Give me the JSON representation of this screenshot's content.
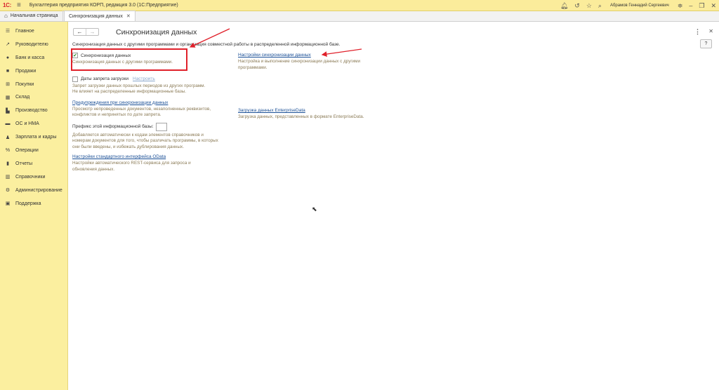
{
  "titlebar": {
    "logo": "1С:",
    "app_title": "Бухгалтерия предприятия КОРП, редакция 3.0  (1С:Предприятие)",
    "user_name": "Абрамов Геннадий Сергеевич"
  },
  "tabs": {
    "home": "Начальная страница",
    "active": "Синхронизация данных"
  },
  "sidebar": {
    "items": [
      {
        "label": "Главное",
        "icon": "menu-icon"
      },
      {
        "label": "Руководителю",
        "icon": "trend-icon"
      },
      {
        "label": "Банк и касса",
        "icon": "coins-icon"
      },
      {
        "label": "Продажи",
        "icon": "bag-icon"
      },
      {
        "label": "Покупки",
        "icon": "cart-icon"
      },
      {
        "label": "Склад",
        "icon": "warehouse-icon"
      },
      {
        "label": "Производство",
        "icon": "factory-icon"
      },
      {
        "label": "ОС и НМА",
        "icon": "truck-icon"
      },
      {
        "label": "Зарплата и кадры",
        "icon": "person-icon"
      },
      {
        "label": "Операции",
        "icon": "percent-icon"
      },
      {
        "label": "Отчеты",
        "icon": "chart-icon"
      },
      {
        "label": "Справочники",
        "icon": "books-icon"
      },
      {
        "label": "Администрирование",
        "icon": "gear-icon"
      },
      {
        "label": "Поддержка",
        "icon": "support-icon"
      }
    ]
  },
  "main": {
    "title": "Синхронизация данных",
    "intro": "Синхронизация данных с другими программами и организация совместной работы в распределенной информационной базе.",
    "sync": {
      "label": "Синхронизация данных",
      "checked": true,
      "desc": "Синхронизация данных с другими программами."
    },
    "ban_dates": {
      "label": "Даты запрета загрузки",
      "link": "Настроить",
      "desc_1": "Запрет загрузки данных прошлых периодов из других программ.",
      "desc_2": "Не влияет на распределенные информационные базы."
    },
    "warnings": {
      "link": "Предупреждения при синхронизации данных",
      "desc_1": "Просмотр непроведенных документов, незаполненных реквизитов,",
      "desc_2": "конфликтов и непринятых по дате запрета."
    },
    "prefix": {
      "label": "Префикс этой информационной базы:",
      "value": "",
      "desc_1": "Добавляется автоматически к кодам элементов справочников и",
      "desc_2": "номерам документов для того, чтобы различать программы, в которых",
      "desc_3": "они были введены, и избежать дублирования данных."
    },
    "odata": {
      "link": "Настройки стандартного интерфейса OData",
      "desc_1": "Настройки автоматического REST-сервиса для запроса и",
      "desc_2": "обновления данных."
    },
    "sync_settings": {
      "link": "Настройки синхронизации данных",
      "desc_1": "Настройка и выполнение синхронизации данных с другими",
      "desc_2": "программами."
    },
    "enterprise_data": {
      "link": "Загрузка данных EnterpriseData",
      "desc": "Загрузка данных, представленных в формате EnterpriseData."
    },
    "help": "?"
  },
  "colors": {
    "accent_yellow": "#fbef9f",
    "link_blue": "#1a4f96",
    "highlight_red": "#e0202a",
    "desc_text": "#8a7a55"
  }
}
